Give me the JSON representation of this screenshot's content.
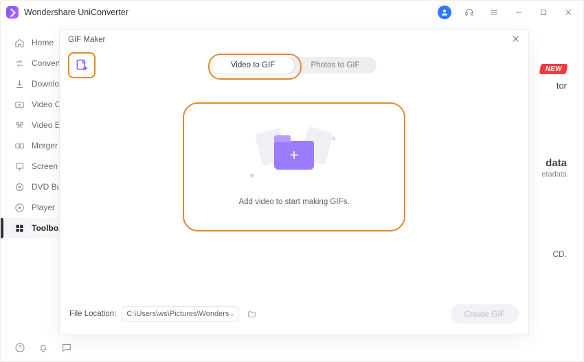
{
  "app": {
    "title": "Wondershare UniConverter"
  },
  "sidebar": {
    "items": [
      {
        "label": "Home"
      },
      {
        "label": "Converter"
      },
      {
        "label": "Downloader"
      },
      {
        "label": "Video Compressor"
      },
      {
        "label": "Video Editor"
      },
      {
        "label": "Merger"
      },
      {
        "label": "Screen Recorder"
      },
      {
        "label": "DVD Burner"
      },
      {
        "label": "Player"
      },
      {
        "label": "Toolbox"
      }
    ]
  },
  "hints": {
    "new": "NEW",
    "tor_suffix": "tor",
    "data_title": "data",
    "data_sub": "etadata",
    "cd": "CD."
  },
  "modal": {
    "title": "GIF Maker",
    "tabs": {
      "video": "Video to GIF",
      "photos": "Photos to GIF"
    },
    "drop_text": "Add video to start making GIFs.",
    "footer": {
      "label": "File Location:",
      "path": "C:\\Users\\ws\\Pictures\\Wonders",
      "create": "Create GIF"
    }
  }
}
